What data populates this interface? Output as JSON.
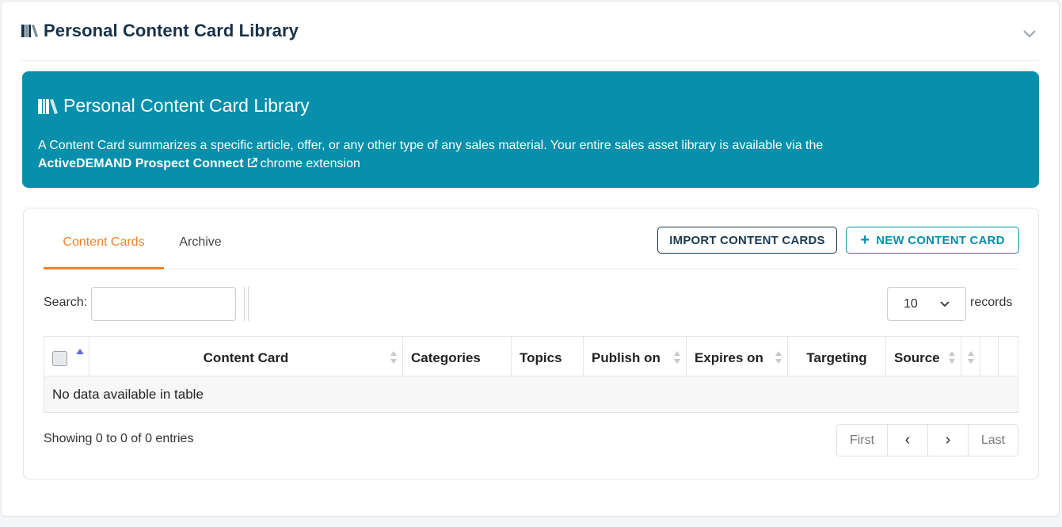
{
  "header": {
    "title": "Personal Content Card Library",
    "icon": "library-books-icon",
    "collapse_icon": "chevron-down-icon"
  },
  "banner": {
    "title": "Personal Content Card Library",
    "text_before": "A Content Card summarizes a specific article, offer, or any other type of any sales material. Your entire sales asset library is available via the",
    "link_text": "ActiveDEMAND Prospect Connect",
    "text_after": "chrome extension",
    "background": "#078fab"
  },
  "tabs": [
    {
      "label": "Content Cards",
      "active": true
    },
    {
      "label": "Archive",
      "active": false
    }
  ],
  "actions": {
    "import_label": "IMPORT CONTENT CARDS",
    "new_label": "NEW CONTENT CARD"
  },
  "search": {
    "label": "Search:",
    "value": "",
    "placeholder": ""
  },
  "records": {
    "selected": "10",
    "label": "records"
  },
  "table": {
    "columns": [
      "Content Card",
      "Categories",
      "Topics",
      "Publish on",
      "Expires on",
      "Targeting",
      "Source"
    ],
    "empty_message": "No data available in table"
  },
  "footer": {
    "info": "Showing 0 to 0 of 0 entries",
    "pager": {
      "first": "First",
      "prev": "‹",
      "next": "›",
      "last": "Last"
    }
  },
  "colors": {
    "accent_orange": "#f0822a",
    "teal": "#078fab",
    "navy": "#17324a"
  }
}
